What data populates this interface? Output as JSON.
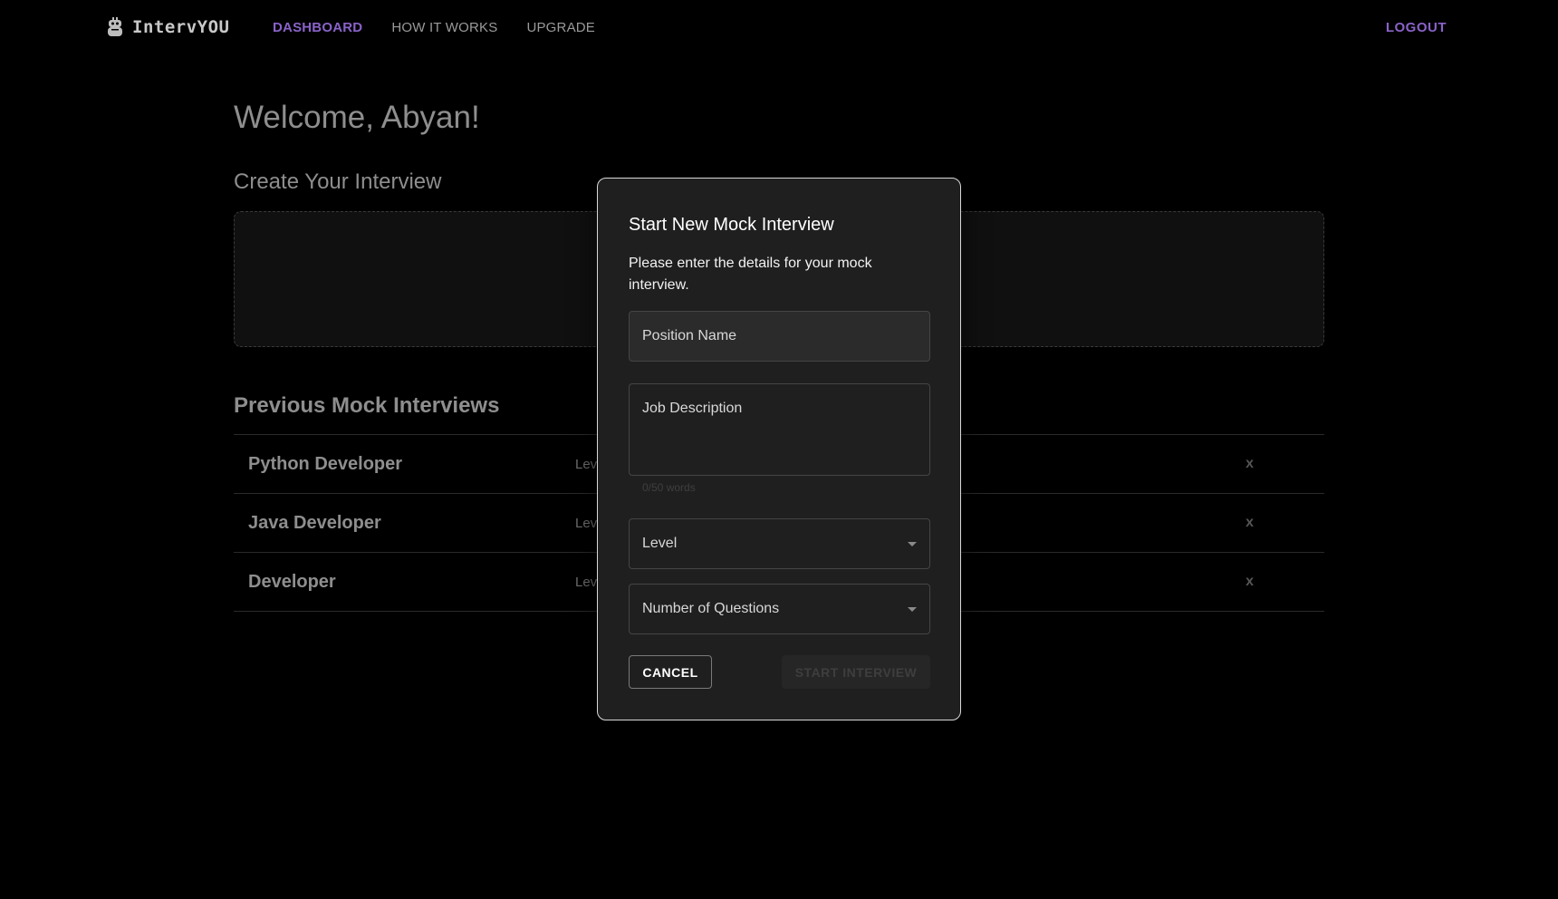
{
  "nav": {
    "brand": "IntervYOU",
    "links": [
      "DASHBOARD",
      "HOW IT WORKS",
      "UPGRADE"
    ],
    "active_link": "DASHBOARD",
    "logout": "LOGOUT"
  },
  "main": {
    "welcome": "Welcome, Abyan!",
    "create_heading": "Create Your Interview",
    "previous_heading": "Previous Mock Interviews",
    "previous_interviews": [
      {
        "title": "Python Developer",
        "level": "Lev",
        "delete": "x"
      },
      {
        "title": "Java Developer",
        "level": "Lev",
        "delete": "x"
      },
      {
        "title": "Developer",
        "level": "Lev",
        "delete": "x"
      }
    ]
  },
  "modal": {
    "title": "Start New Mock Interview",
    "description": "Please enter the details for your mock interview.",
    "position_label": "Position Name",
    "job_description_label": "Job Description",
    "word_count": "0/50 words",
    "level_label": "Level",
    "questions_label": "Number of Questions",
    "cancel_label": "CANCEL",
    "start_label": "START INTERVIEW"
  },
  "colors": {
    "accent": "#8a63c9",
    "background": "#000000",
    "modal_bg": "#1f1f1f"
  },
  "icons": {
    "brand": "robot-icon",
    "dropdown": "caret-down-icon"
  }
}
